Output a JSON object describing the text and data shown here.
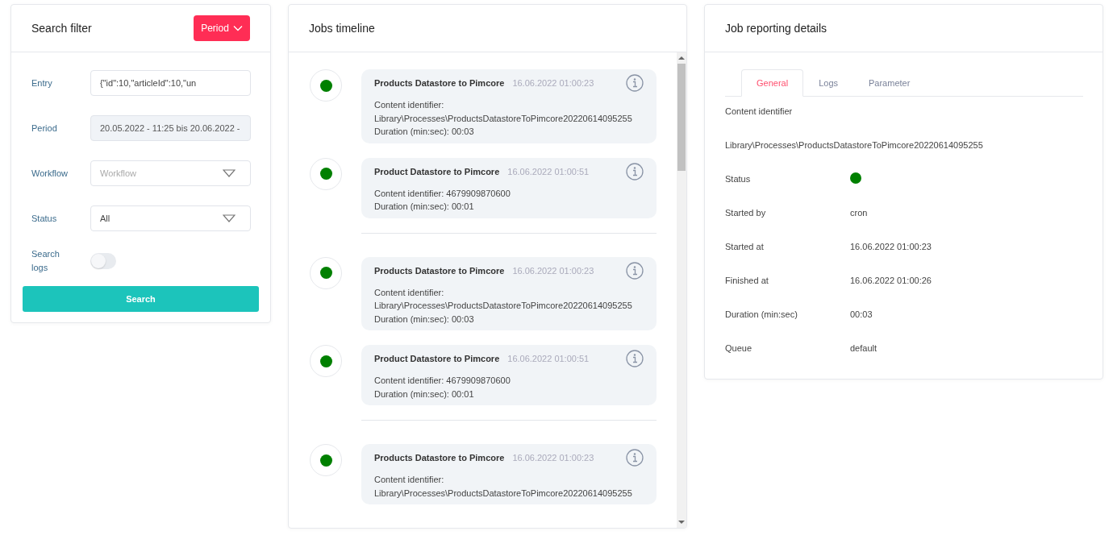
{
  "search_filter": {
    "title": "Search filter",
    "period_button": "Period",
    "fields": [
      {
        "kind": "text",
        "label": "Entry",
        "value": "{\"id\":10,\"articleId\":10,\"un"
      },
      {
        "kind": "text",
        "label": "Period",
        "value": "20.05.2022 - 11:25 bis 20.06.2022 -",
        "disabled": true
      },
      {
        "kind": "select",
        "label": "Workflow",
        "placeholder": "Workflow"
      },
      {
        "kind": "select",
        "label": "Status",
        "value": "All"
      },
      {
        "kind": "toggle",
        "label": "Search logs",
        "on": false
      }
    ],
    "search_button": "Search"
  },
  "jobs_timeline": {
    "title": "Jobs timeline",
    "groups": [
      {
        "jobs": [
          {
            "name": "Products Datastore to Pimcore",
            "time": "16.06.2022 01:00:23",
            "color": "#008000",
            "lines": [
              "Content identifier:",
              "Library\\Processes\\ProductsDatastoreToPimcore20220614095255",
              "Duration (min:sec): 00:03"
            ]
          },
          {
            "name": "Product Datastore to Pimcore",
            "time": "16.06.2022 01:00:51",
            "color": "#008000",
            "lines": [
              "Content identifier: 4679909870600",
              "Duration (min:sec): 00:01"
            ]
          }
        ]
      },
      {
        "jobs": [
          {
            "name": "Products Datastore to Pimcore",
            "time": "16.06.2022 01:00:23",
            "color": "#008000",
            "lines": [
              "Content identifier:",
              "Library\\Processes\\ProductsDatastoreToPimcore20220614095255",
              "Duration (min:sec): 00:03"
            ]
          },
          {
            "name": "Product Datastore to Pimcore",
            "time": "16.06.2022 01:00:51",
            "color": "#008000",
            "lines": [
              "Content identifier: 4679909870600",
              "Duration (min:sec): 00:01"
            ]
          }
        ]
      },
      {
        "jobs": [
          {
            "name": "Products Datastore to Pimcore",
            "time": "16.06.2022 01:00:23",
            "color": "#008000",
            "lines": [
              "Content identifier:",
              "Library\\Processes\\ProductsDatastoreToPimcore20220614095255"
            ]
          }
        ]
      }
    ]
  },
  "job_details": {
    "title": "Job reporting details",
    "tabs": [
      {
        "label": "General",
        "selected": true
      },
      {
        "label": "Logs",
        "selected": false
      },
      {
        "label": "Parameter",
        "selected": false
      }
    ],
    "content_identifier_label": "Content identifier",
    "content_identifier": "Library\\Processes\\ProductsDatastoreToPimcore20220614095255",
    "rows": [
      {
        "kind": "status",
        "label": "Status",
        "color": "#008000"
      },
      {
        "kind": "text",
        "label": "Started by",
        "value": "cron"
      },
      {
        "kind": "text",
        "label": "Started at",
        "value": "16.06.2022 01:00:23"
      },
      {
        "kind": "text",
        "label": "Finished at",
        "value": "16.06.2022 01:00:26"
      },
      {
        "kind": "text",
        "label": "Duration (min:sec)",
        "value": "00:03"
      },
      {
        "kind": "text",
        "label": "Queue",
        "value": "default"
      }
    ]
  }
}
